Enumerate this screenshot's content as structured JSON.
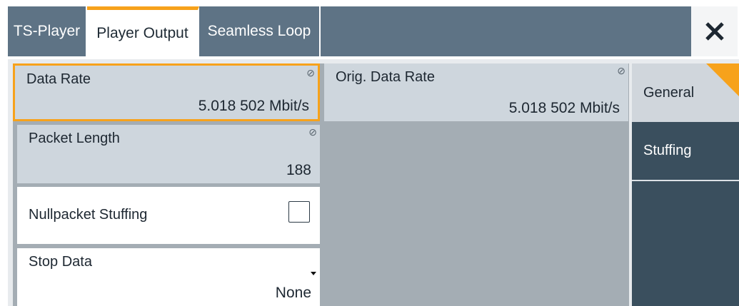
{
  "tabs": {
    "ts_player": "TS-Player",
    "player_output": "Player Output",
    "seamless_loop": "Seamless Loop"
  },
  "fields": {
    "data_rate": {
      "label": "Data Rate",
      "value": "5.018 502 Mbit/s"
    },
    "orig_data_rate": {
      "label": "Orig. Data Rate",
      "value": "5.018 502 Mbit/s"
    },
    "packet_length": {
      "label": "Packet Length",
      "value": "188"
    },
    "nullpacket_stuffing": {
      "label": "Nullpacket Stuffing",
      "checked": false
    },
    "stop_data": {
      "label": "Stop Data",
      "value": "None"
    }
  },
  "side_tabs": {
    "general": "General",
    "stuffing": "Stuffing"
  },
  "colors": {
    "accent": "#f7a21b",
    "tabbar": "#5e7385",
    "sidetab_dark": "#3a4f5e"
  },
  "icons": {
    "close": "close-icon",
    "lock": "read-only-icon",
    "dropdown": "dropdown-arrow-icon"
  }
}
